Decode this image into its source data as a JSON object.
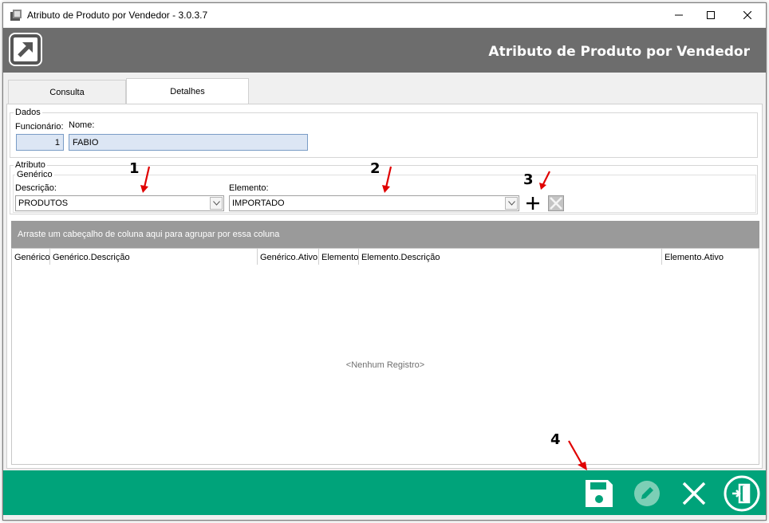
{
  "window": {
    "title": "Atributo de Produto por Vendedor - 3.0.3.7"
  },
  "banner": {
    "title": "Atributo de Produto por Vendedor"
  },
  "tabs": [
    {
      "label": "Consulta",
      "active": false
    },
    {
      "label": "Detalhes",
      "active": true
    }
  ],
  "dados": {
    "legend": "Dados",
    "funcionario_label": "Funcionário:",
    "funcionario_value": "1",
    "nome_label": "Nome:",
    "nome_value": "FABIO"
  },
  "atributo": {
    "legend": "Atributo",
    "generico_legend": "Genérico",
    "descricao_label": "Descrição:",
    "descricao_value": "PRODUTOS",
    "elemento_label": "Elemento:",
    "elemento_value": "IMPORTADO"
  },
  "grid": {
    "group_hint": "Arraste um cabeçalho de coluna aqui para agrupar por essa coluna",
    "columns": [
      "Genérico",
      "Genérico.Descrição",
      "Genérico.Ativo",
      "Elemento",
      "Elemento.Descrição",
      "Elemento.Ativo"
    ],
    "empty_text": "<Nenhum Registro>"
  },
  "annotations": [
    "1",
    "2",
    "3",
    "4"
  ],
  "colors": {
    "banner": "#6d6d6d",
    "footer": "#00a37a",
    "arrow": "#e00000"
  },
  "icons": [
    "app-icon",
    "minimize-icon",
    "maximize-icon",
    "close-icon",
    "logo-arrow-icon",
    "add-icon",
    "delete-icon",
    "save-icon",
    "edit-icon",
    "cancel-icon",
    "exit-icon"
  ]
}
